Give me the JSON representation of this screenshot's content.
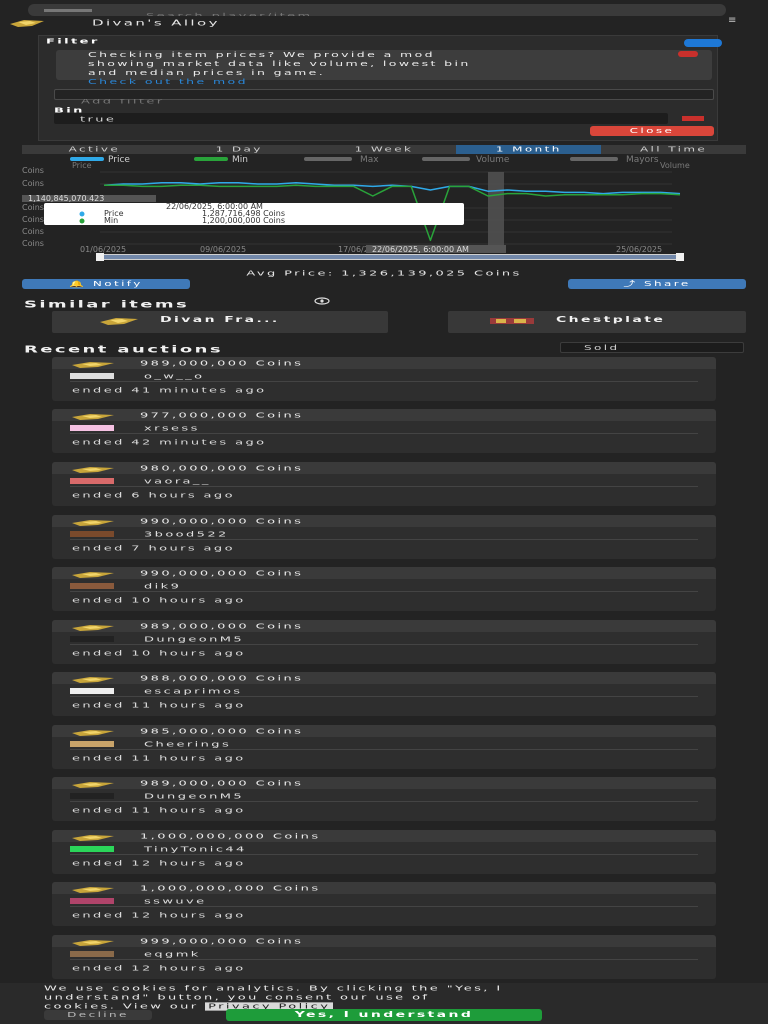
{
  "search": {
    "placeholder": "Search player/item"
  },
  "item": {
    "name": "Divan's Alloy"
  },
  "filter": {
    "label": "Filter",
    "alert_line1": "Checking item prices? We provide a mod",
    "alert_line2": "showing market data like volume, lowest bin",
    "alert_line3": "and median prices in game.",
    "alert_link": "Check out the mod",
    "add_placeholder": "Add filter",
    "bin_label": "Bin",
    "bin_value": "true",
    "close_label": "Close"
  },
  "ranges": [
    {
      "label": "Active"
    },
    {
      "label": "1 Day"
    },
    {
      "label": "1 Week"
    },
    {
      "label": "1 Month",
      "active": true
    },
    {
      "label": "All Time"
    }
  ],
  "legend": [
    {
      "name": "Price",
      "color": "#2fa9e8"
    },
    {
      "name": "Min",
      "color": "#29a33a"
    },
    {
      "name": "Max",
      "color": "#666666"
    },
    {
      "name": "Volume",
      "color": "#666666"
    },
    {
      "name": "Mayors",
      "color": "#666666"
    }
  ],
  "legend_extra": {
    "price_sub": "Price",
    "volume_sub": "Volume"
  },
  "chart_data": {
    "type": "line",
    "y_tick_labels": [
      "Coins",
      "Coins",
      "Coins",
      "Coins",
      "Coins",
      "Coins"
    ],
    "x_tick_labels": [
      "01/06/2025",
      "09/06/2025",
      "17/06/2025",
      "25/06/2025"
    ],
    "crosshair_y_label": "1,140,845,070.423",
    "crosshair_x_label": "22/06/2025, 6:00:00 AM",
    "tooltip": {
      "title": "22/06/2025, 6:00:00 AM",
      "rows": [
        {
          "name": "Price",
          "value": "1,287,716,498 Coins",
          "color": "#2fa9e8"
        },
        {
          "name": "Min",
          "value": "1,200,000,000 Coins",
          "color": "#29a33a"
        }
      ]
    },
    "series": [
      {
        "name": "Price",
        "color": "#2fa9e8",
        "values": [
          1.34,
          1.35,
          1.35,
          1.36,
          1.36,
          1.35,
          1.36,
          1.36,
          1.35,
          1.35,
          1.36,
          1.35,
          1.34,
          1.34,
          1.33,
          1.34,
          1.33,
          1.3,
          1.33,
          1.33,
          1.29,
          1.3,
          1.29,
          1.29,
          1.28,
          1.28,
          1.27,
          1.28,
          1.28,
          1.28,
          1.27
        ]
      },
      {
        "name": "Min",
        "color": "#29a33a",
        "values": [
          1.34,
          1.34,
          1.33,
          1.33,
          1.34,
          1.34,
          1.33,
          1.33,
          1.33,
          1.33,
          1.34,
          1.33,
          1.33,
          1.33,
          1.25,
          1.33,
          1.33,
          0.88,
          1.33,
          1.33,
          1.25,
          1.27,
          1.27,
          1.25,
          1.26,
          1.26,
          1.26,
          1.26,
          1.27,
          1.27,
          1.26
        ]
      }
    ],
    "ylim": [
      0.85,
      1.45
    ]
  },
  "avg_price": "Avg Price: 1,326,139,025 Coins",
  "notify_label": "Notify",
  "share_label": "Share",
  "similar": {
    "title": "Similar items",
    "items": [
      {
        "name": "Divan Fra..."
      },
      {
        "name": "Chestplate"
      }
    ]
  },
  "recent": {
    "title": "Recent auctions",
    "filter_value": "Sold",
    "auctions": [
      {
        "price": "989,000,000 Coins",
        "seller": "o_w__o",
        "ended": "ended 41 minutes ago",
        "avatar_color": "#dddddd"
      },
      {
        "price": "977,000,000 Coins",
        "seller": "xrsess",
        "ended": "ended 42 minutes ago",
        "avatar_color": "#f5c1e2"
      },
      {
        "price": "980,000,000 Coins",
        "seller": "vaora__",
        "ended": "ended 6 hours ago",
        "avatar_color": "#d86a6a"
      },
      {
        "price": "990,000,000 Coins",
        "seller": "3bood522",
        "ended": "ended 7 hours ago",
        "avatar_color": "#7a4a2c"
      },
      {
        "price": "990,000,000 Coins",
        "seller": "dik9",
        "ended": "ended 10 hours ago",
        "avatar_color": "#8a5a3c"
      },
      {
        "price": "989,000,000 Coins",
        "seller": "DungeonM5",
        "ended": "ended 10 hours ago",
        "avatar_color": "#222222"
      },
      {
        "price": "988,000,000 Coins",
        "seller": "escaprimos",
        "ended": "ended 11 hours ago",
        "avatar_color": "#eeeeee"
      },
      {
        "price": "985,000,000 Coins",
        "seller": "Cheerings",
        "ended": "ended 11 hours ago",
        "avatar_color": "#c9a46a"
      },
      {
        "price": "989,000,000 Coins",
        "seller": "DungeonM5",
        "ended": "ended 11 hours ago",
        "avatar_color": "#222222"
      },
      {
        "price": "1,000,000,000 Coins",
        "seller": "TinyTonic44",
        "ended": "ended 12 hours ago",
        "avatar_color": "#2bd65a"
      },
      {
        "price": "1,000,000,000 Coins",
        "seller": "sswuve",
        "ended": "ended 12 hours ago",
        "avatar_color": "#b0446a"
      },
      {
        "price": "999,000,000 Coins",
        "seller": "eqgmk",
        "ended": "ended 12 hours ago",
        "avatar_color": "#8a6a4a"
      }
    ]
  },
  "cookie": {
    "line1": "We use cookies for analytics. By clicking the \"Yes, I",
    "line2a": "understand\" button, you consent our use of",
    "line3a": "cookies. View our",
    "policy_label": "Privacy Policy",
    "decline_label": "Decline",
    "accept_label": "Yes, I understand"
  },
  "colors": {
    "background": "#232323",
    "card": "#2e2e2e",
    "accent_blue": "#3f79b8",
    "danger": "#d9463a",
    "success": "#1e9c3a"
  }
}
